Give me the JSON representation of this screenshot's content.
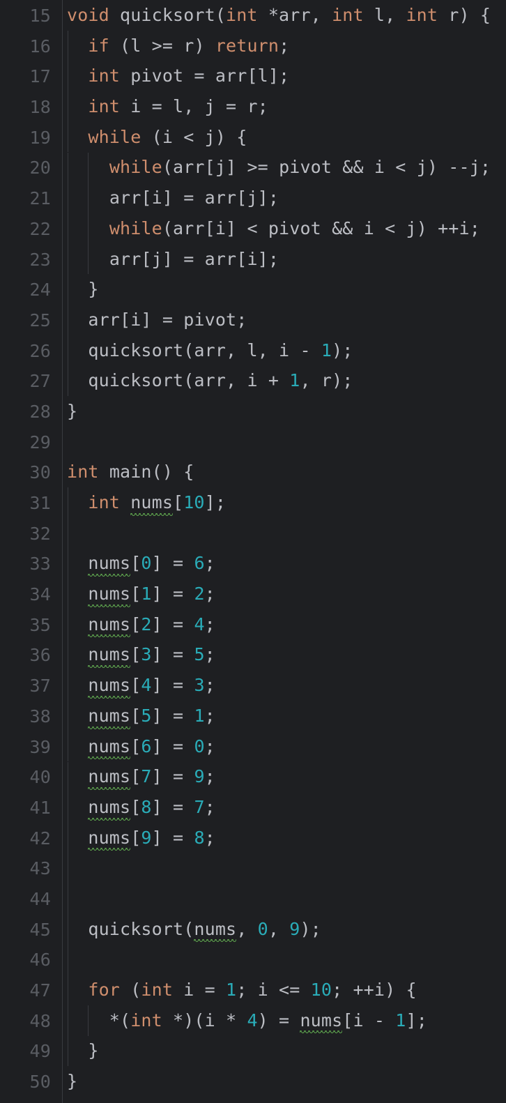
{
  "editor": {
    "language": "C",
    "theme": "dark",
    "background_color": "#1e1f22",
    "gutter_divider_color": "#393b40",
    "line_number_color": "#5a5d63",
    "plain_text_color": "#bcbec4",
    "keyword_color": "#cf8e6d",
    "number_color": "#2aacb8",
    "spellcheck_squiggle_color": "#5a9c4b",
    "first_visible_line": 15,
    "last_visible_line": 50
  },
  "lines": [
    {
      "number": "15",
      "indent": 0,
      "guides": [],
      "text": "void quicksort(int *arr, int l, int r) {"
    },
    {
      "number": "16",
      "indent": 1,
      "guides": [
        0
      ],
      "text": "if (l >= r) return;"
    },
    {
      "number": "17",
      "indent": 1,
      "guides": [
        0
      ],
      "text": "int pivot = arr[l];"
    },
    {
      "number": "18",
      "indent": 1,
      "guides": [
        0
      ],
      "text": "int i = l, j = r;"
    },
    {
      "number": "19",
      "indent": 1,
      "guides": [
        0
      ],
      "text": "while (i < j) {"
    },
    {
      "number": "20",
      "indent": 2,
      "guides": [
        0,
        1
      ],
      "text": "while(arr[j] >= pivot && i < j) --j;"
    },
    {
      "number": "21",
      "indent": 2,
      "guides": [
        0,
        1
      ],
      "text": "arr[i] = arr[j];"
    },
    {
      "number": "22",
      "indent": 2,
      "guides": [
        0,
        1
      ],
      "text": "while(arr[i] < pivot && i < j) ++i;"
    },
    {
      "number": "23",
      "indent": 2,
      "guides": [
        0,
        1
      ],
      "text": "arr[j] = arr[i];"
    },
    {
      "number": "24",
      "indent": 1,
      "guides": [
        0
      ],
      "text": "}"
    },
    {
      "number": "25",
      "indent": 1,
      "guides": [
        0
      ],
      "text": "arr[i] = pivot;"
    },
    {
      "number": "26",
      "indent": 1,
      "guides": [
        0
      ],
      "text": "quicksort(arr, l, i - 1);"
    },
    {
      "number": "27",
      "indent": 1,
      "guides": [
        0
      ],
      "text": "quicksort(arr, i + 1, r);"
    },
    {
      "number": "28",
      "indent": 0,
      "guides": [],
      "text": "}"
    },
    {
      "number": "29",
      "indent": 0,
      "guides": [],
      "text": ""
    },
    {
      "number": "30",
      "indent": 0,
      "guides": [],
      "text": "int main() {"
    },
    {
      "number": "31",
      "indent": 1,
      "guides": [
        0
      ],
      "text": "int nums[10];"
    },
    {
      "number": "32",
      "indent": 0,
      "guides": [
        0
      ],
      "text": ""
    },
    {
      "number": "33",
      "indent": 1,
      "guides": [
        0
      ],
      "text": "nums[0] = 6;"
    },
    {
      "number": "34",
      "indent": 1,
      "guides": [
        0
      ],
      "text": "nums[1] = 2;"
    },
    {
      "number": "35",
      "indent": 1,
      "guides": [
        0
      ],
      "text": "nums[2] = 4;"
    },
    {
      "number": "36",
      "indent": 1,
      "guides": [
        0
      ],
      "text": "nums[3] = 5;"
    },
    {
      "number": "37",
      "indent": 1,
      "guides": [
        0
      ],
      "text": "nums[4] = 3;"
    },
    {
      "number": "38",
      "indent": 1,
      "guides": [
        0
      ],
      "text": "nums[5] = 1;"
    },
    {
      "number": "39",
      "indent": 1,
      "guides": [
        0
      ],
      "text": "nums[6] = 0;"
    },
    {
      "number": "40",
      "indent": 1,
      "guides": [
        0
      ],
      "text": "nums[7] = 9;"
    },
    {
      "number": "41",
      "indent": 1,
      "guides": [
        0
      ],
      "text": "nums[8] = 7;"
    },
    {
      "number": "42",
      "indent": 1,
      "guides": [
        0
      ],
      "text": "nums[9] = 8;"
    },
    {
      "number": "43",
      "indent": 0,
      "guides": [
        0
      ],
      "text": ""
    },
    {
      "number": "44",
      "indent": 0,
      "guides": [
        0
      ],
      "text": ""
    },
    {
      "number": "45",
      "indent": 1,
      "guides": [
        0
      ],
      "text": "quicksort(nums, 0, 9);"
    },
    {
      "number": "46",
      "indent": 0,
      "guides": [
        0
      ],
      "text": ""
    },
    {
      "number": "47",
      "indent": 1,
      "guides": [
        0
      ],
      "text": "for (int i = 1; i <= 10; ++i) {"
    },
    {
      "number": "48",
      "indent": 2,
      "guides": [
        0,
        1
      ],
      "text": "*(int *)(i * 4) = nums[i - 1];"
    },
    {
      "number": "49",
      "indent": 1,
      "guides": [
        0
      ],
      "text": "}"
    },
    {
      "number": "50",
      "indent": 0,
      "guides": [],
      "text": "}"
    }
  ],
  "code_text": "void quicksort(int *arr, int l, int r) {\n  if (l >= r) return;\n  int pivot = arr[l];\n  int i = l, j = r;\n  while (i < j) {\n    while(arr[j] >= pivot && i < j) --j;\n    arr[i] = arr[j];\n    while(arr[i] < pivot && i < j) ++i;\n    arr[j] = arr[i];\n  }\n  arr[i] = pivot;\n  quicksort(arr, l, i - 1);\n  quicksort(arr, i + 1, r);\n}\n\nint main() {\n  int nums[10];\n\n  nums[0] = 6;\n  nums[1] = 2;\n  nums[2] = 4;\n  nums[3] = 5;\n  nums[4] = 3;\n  nums[5] = 1;\n  nums[6] = 0;\n  nums[7] = 9;\n  nums[8] = 7;\n  nums[9] = 8;\n\n\n  quicksort(nums, 0, 9);\n\n  for (int i = 1; i <= 10; ++i) {\n    *(int *)(i * 4) = nums[i - 1];\n  }\n}",
  "keywords": [
    "void",
    "int",
    "if",
    "return",
    "while",
    "for"
  ],
  "spellcheck_words": [
    "nums"
  ],
  "array_values": [
    6,
    2,
    4,
    5,
    3,
    1,
    0,
    9,
    7,
    8
  ]
}
